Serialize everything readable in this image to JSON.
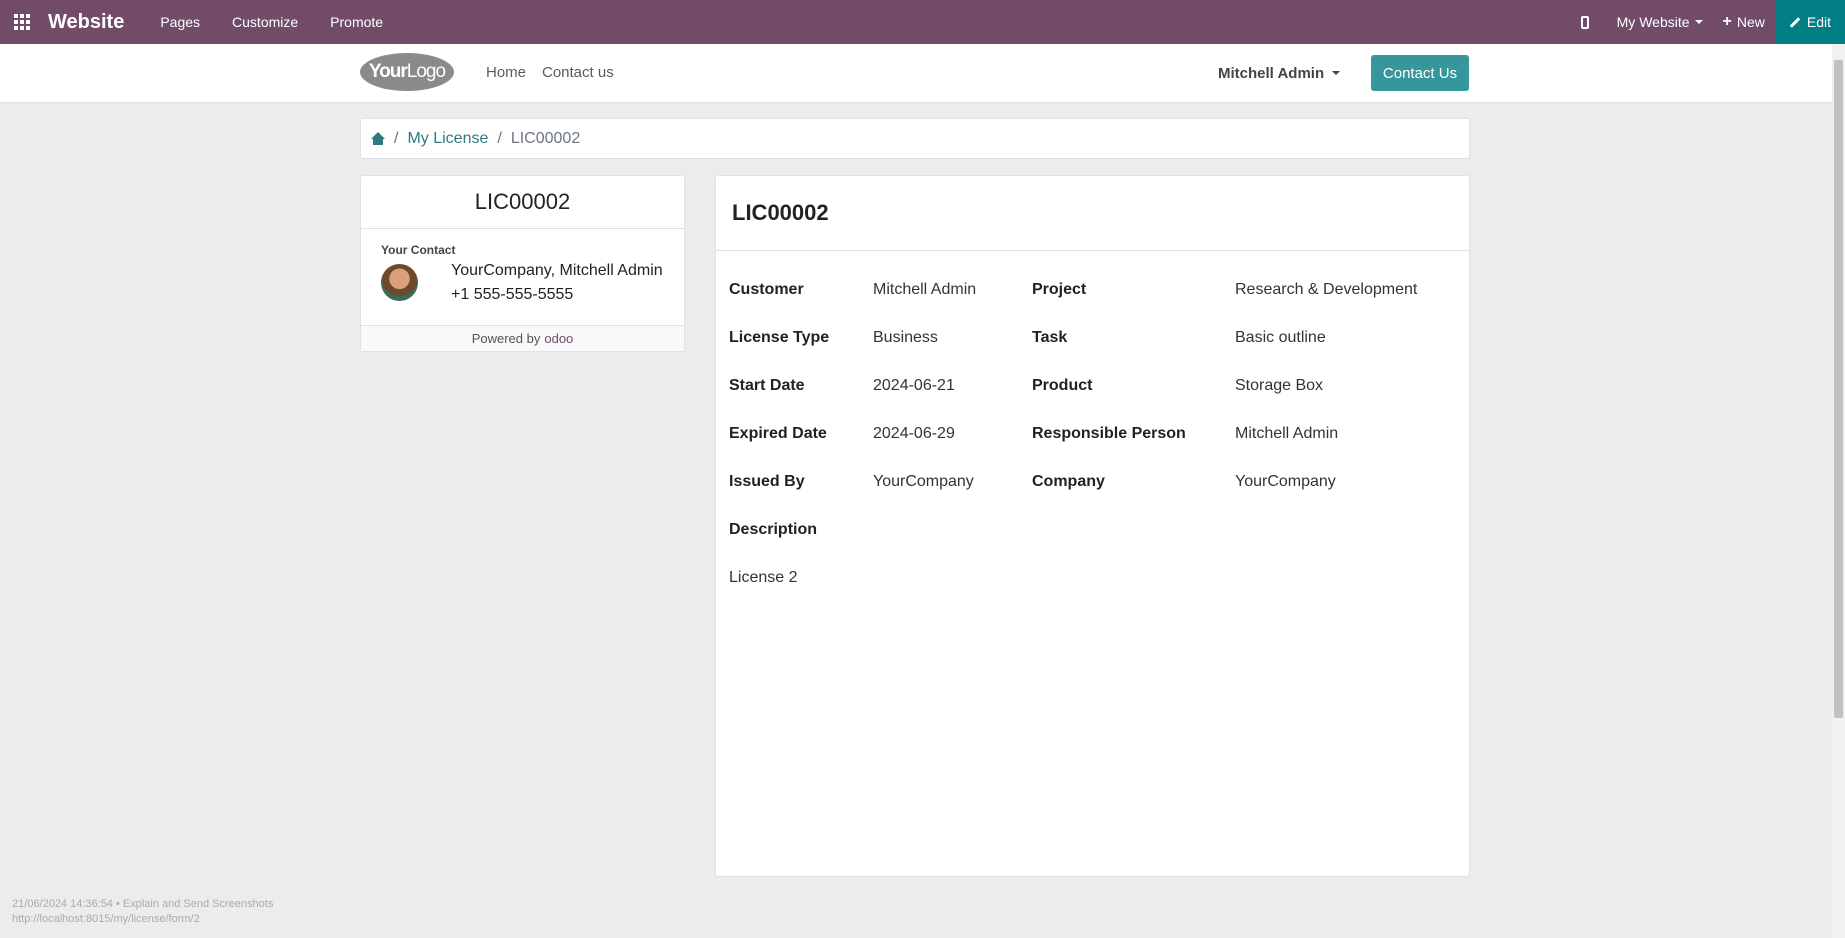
{
  "topbar": {
    "brand": "Website",
    "menus": [
      "Pages",
      "Customize",
      "Promote"
    ],
    "my_website": "My Website",
    "new_label": "New",
    "edit_label": "Edit"
  },
  "header": {
    "logo_bold": "Your",
    "logo_rest": "Logo",
    "nav": [
      "Home",
      "Contact us"
    ],
    "user": "Mitchell Admin",
    "contact_button": "Contact Us"
  },
  "breadcrumb": {
    "sep": "/",
    "parent": "My License",
    "current": "LIC00002"
  },
  "left_card": {
    "title": "LIC00002",
    "contact_label": "Your Contact",
    "contact_name": "YourCompany, Mitchell Admin",
    "contact_phone": "+1 555-555-5555",
    "powered_by": "Powered by",
    "odoo_o": "o",
    "odoo_rest": "doo"
  },
  "main_card": {
    "title": "LIC00002",
    "fields": {
      "customer": {
        "label": "Customer",
        "value": "Mitchell Admin"
      },
      "project": {
        "label": "Project",
        "value": "Research & Development"
      },
      "license_type": {
        "label": "License Type",
        "value": "Business"
      },
      "task": {
        "label": "Task",
        "value": "Basic outline"
      },
      "start_date": {
        "label": "Start Date",
        "value": "2024-06-21"
      },
      "product": {
        "label": "Product",
        "value": "Storage Box"
      },
      "expired_date": {
        "label": "Expired Date",
        "value": "2024-06-29"
      },
      "responsible_person": {
        "label": "Responsible Person",
        "value": "Mitchell Admin"
      },
      "issued_by": {
        "label": "Issued By",
        "value": "YourCompany"
      },
      "company": {
        "label": "Company",
        "value": "YourCompany"
      },
      "description": {
        "label": "Description",
        "value": "License 2"
      }
    }
  },
  "debug": {
    "line1": "21/06/2024 14:36:54 • Explain and Send Screenshots",
    "line2": "http://localhost:8015/my/license/form/2"
  },
  "colors": {
    "topbar": "#714b67",
    "edit": "#017e84",
    "accent": "#35979c",
    "link": "#2d7b80"
  }
}
